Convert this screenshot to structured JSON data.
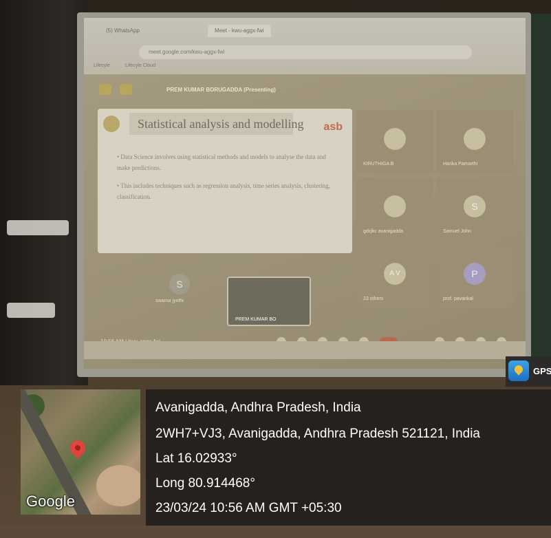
{
  "browser": {
    "tabs": [
      "(5) WhatsApp",
      "Meet - kwu-aggx-fwi"
    ],
    "url": "meet.google.com/kwu-aggx-fwi",
    "bookmarks": [
      "Lifecyle",
      "Lifecyle Cloud"
    ]
  },
  "meet": {
    "presenter": "PREM KUMAR BORUGADDA (Presenting)",
    "slide": {
      "title": "Statistical analysis and modelling",
      "brand": "asb",
      "bullets": [
        "• Data Science involves using statistical methods and models to analyse the data and make predictions.",
        "• This includes techniques such as regression analysis, time series analysis, clustering, classification."
      ]
    },
    "participants": [
      {
        "name": "KIRUTHIGA B",
        "initial": ""
      },
      {
        "name": "Harika Pamarthi",
        "initial": ""
      },
      {
        "name": "gdcjkc avanigadda",
        "initial": ""
      },
      {
        "name": "Samuel John",
        "initial": "S"
      },
      {
        "name": "23 others",
        "initial": "A V"
      },
      {
        "name": "prof. pavankal",
        "initial": "P"
      }
    ],
    "small_tile": {
      "name": "swarna jyothi",
      "initial": "S"
    },
    "self_view_label": "PREM KUMAR BO",
    "time_code": "10:56 AM | kwu-aggx-fwi"
  },
  "gps_badge": "GPS",
  "map_label": "Google",
  "location": {
    "line1": "Avanigadda, Andhra Pradesh, India",
    "line2": "2WH7+VJ3, Avanigadda, Andhra Pradesh 521121, India",
    "lat": "Lat 16.02933°",
    "long": "Long 80.914468°",
    "datetime": "23/03/24 10:56 AM GMT +05:30"
  }
}
